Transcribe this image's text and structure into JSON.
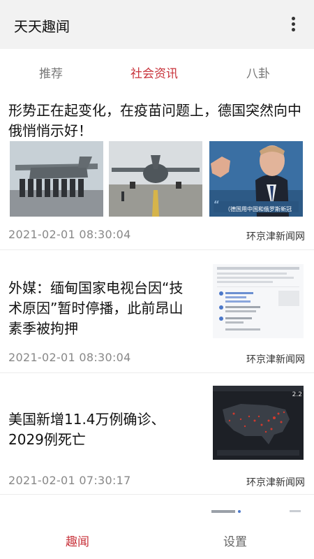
{
  "app": {
    "title": "天天趣闻"
  },
  "tabs": [
    {
      "label": "推荐",
      "active": false
    },
    {
      "label": "社会资讯",
      "active": true
    },
    {
      "label": "八卦",
      "active": false
    }
  ],
  "feed": [
    {
      "headline": "形势正在起变化，在疫苗问题上，德国突然向中俄悄悄示好！",
      "time": "2021-02-01 08:30:04",
      "source": "环京津新闻网",
      "thumb_caption": "（德国用中国和俄罗斯新冠"
    },
    {
      "headline": "外媒：缅甸国家电视台因“技术原因”暂时停播，此前昂山素季被拘押",
      "time": "2021-02-01 08:30:04",
      "source": "环京津新闻网"
    },
    {
      "headline": "美国新增11.4万例确诊、2029例死亡",
      "time": "2021-02-01 07:30:17",
      "source": "环京津新闻网",
      "thumb_caption": "2.2"
    }
  ],
  "bottom_nav": [
    {
      "label": "趣闻",
      "active": true
    },
    {
      "label": "设置",
      "active": false
    }
  ],
  "colors": {
    "accent": "#c8333b",
    "appbar_bg": "#f2f2f2"
  },
  "icons": {
    "menu": "more-vertical-icon"
  }
}
